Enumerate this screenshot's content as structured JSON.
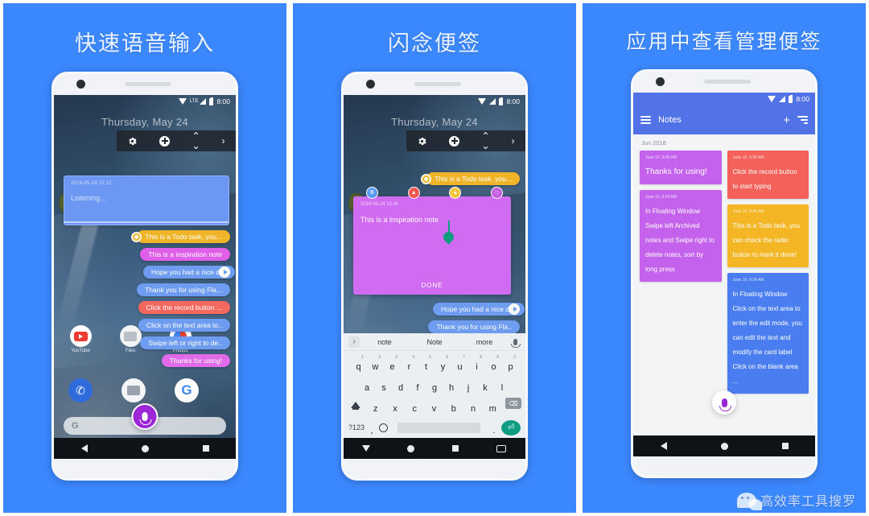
{
  "panels": [
    {
      "title": "快速语音输入",
      "status": {
        "time": "8:00",
        "signal_label": "LTE"
      },
      "home": {
        "date": "Thursday, May 24",
        "toolbar_icons": [
          "gear-icon",
          "plus-circle-icon",
          "up-down-arrow-icon",
          "chevron-right-icon"
        ],
        "listening_card": {
          "timestamp": "2018-05-24 13:12",
          "text": "Listening..."
        },
        "bubbles": [
          {
            "text": "This is a Todo task, you...",
            "color": "#f0b429",
            "kind": "todo"
          },
          {
            "text": "This is a  inspiration note",
            "color": "#df5fe8",
            "kind": "note"
          },
          {
            "text": "Hope you had a nice day",
            "color": "#6e9cf0",
            "kind": "audio"
          },
          {
            "text": "Thank you for using Fla...",
            "color": "#6e9cf0",
            "kind": "note"
          },
          {
            "text": "Click the record button ...",
            "color": "#f4685f",
            "kind": "note"
          },
          {
            "text": "Click on the text area to..",
            "color": "#6e9cf0",
            "kind": "note"
          },
          {
            "text": "Swipe left or right to de..",
            "color": "#6e9cf0",
            "kind": "note"
          },
          {
            "text": "Thanks for using!",
            "color": "#e06ae8",
            "kind": "note"
          }
        ],
        "apps": [
          {
            "label": "YouTube",
            "icon": "youtube-icon"
          },
          {
            "label": "Files",
            "icon": "files-icon"
          },
          {
            "label": "Photos",
            "icon": "photos-icon"
          }
        ],
        "dock": [
          {
            "label": "Phone",
            "icon": "phone-icon",
            "glyph": "✆"
          },
          {
            "label": "Messages",
            "icon": "messages-icon",
            "glyph": ""
          },
          {
            "label": "Google",
            "icon": "google-icon",
            "glyph": "G"
          }
        ],
        "search_placeholder": "G",
        "mic_fab": "mic-icon"
      }
    },
    {
      "title": "闪念便签",
      "status": {
        "time": "8:00"
      },
      "home": {
        "date": "Thursday, May 24",
        "todo_bubble": "This is a Todo task, you...",
        "edit_card": {
          "timestamp": "2018-05-24 12:40",
          "text": "This is a  inspiration note",
          "done_label": "DONE"
        },
        "labels": [
          {
            "name": "label-blue",
            "color": "#5b9bf5",
            "glyph": "B"
          },
          {
            "name": "label-red",
            "color": "#f2584f",
            "glyph": "▲"
          },
          {
            "name": "label-yellow",
            "color": "#f6c544",
            "glyph": "✦"
          },
          {
            "name": "label-purple",
            "color": "#c45fe0",
            "glyph": "♡"
          }
        ],
        "bubbles": [
          {
            "text": "Hope you had a nice day",
            "color": "#6e9cf0",
            "kind": "audio"
          },
          {
            "text": "Thank you for using Fla..",
            "color": "#6e9cf0",
            "kind": "note"
          }
        ]
      },
      "keyboard": {
        "suggestions": [
          "note",
          "Note",
          "more"
        ],
        "expand_icon": "chevron-right-icon",
        "mic_icon": "mic-icon",
        "row1": [
          {
            "k": "q",
            "n": "1"
          },
          {
            "k": "w",
            "n": "2"
          },
          {
            "k": "e",
            "n": "3"
          },
          {
            "k": "r",
            "n": "4"
          },
          {
            "k": "t",
            "n": "5"
          },
          {
            "k": "y",
            "n": "6"
          },
          {
            "k": "u",
            "n": "7"
          },
          {
            "k": "i",
            "n": "8"
          },
          {
            "k": "o",
            "n": "9"
          },
          {
            "k": "p",
            "n": "0"
          }
        ],
        "row2": [
          "a",
          "s",
          "d",
          "f",
          "g",
          "h",
          "j",
          "k",
          "l"
        ],
        "row3": [
          "z",
          "x",
          "c",
          "v",
          "b",
          "n",
          "m"
        ],
        "num_key": "?123",
        "comma_key": ",",
        "period_key": ".",
        "emoji_key": "emoji-icon",
        "shift_key": "shift-icon",
        "backspace_key": "backspace-icon",
        "enter_key": "enter-icon",
        "space_key": "space-bar"
      }
    },
    {
      "title": "应用中查看管理便签",
      "status": {
        "time": "8:00"
      },
      "notes_app": {
        "app_title": "Notes",
        "menu_icon": "hamburger-menu-icon",
        "add_icon": "plus-icon",
        "sort_icon": "sort-icon",
        "month_header": "Jun 2018",
        "cards_left": [
          {
            "timestamp": "June 10, 9:36 AM",
            "text": "Thanks for using!",
            "color": "#c462ee",
            "size": "big"
          },
          {
            "timestamp": "June 10, 9:34 AM",
            "text": "In Floating Window Swipe left Archived notes and Swipe right to delete notes, sort by long press",
            "color": "#c462ee",
            "size": "normal"
          }
        ],
        "cards_right": [
          {
            "timestamp": "June 10, 9:35 AM",
            "text": "Click the record button to start typing",
            "color": "#f4615a",
            "size": "normal"
          },
          {
            "timestamp": "June 10, 9:35 AM",
            "text": "This is a Todo task, you can check the radio button to mark it done!",
            "color": "#f5b625",
            "size": "normal"
          },
          {
            "timestamp": "June 10, 9:34 AM",
            "text": "In Floating Window Click on the text area to enter the edit mode, you can edit the text and modify the card label Click on the blank area ...",
            "color": "#4a7ef0",
            "size": "normal"
          }
        ],
        "fab_icon": "mic-icon"
      }
    }
  ],
  "watermark": {
    "text": "高效率工具搜罗",
    "icon": "wechat-icon"
  },
  "colors": {
    "background": "#3b87fd",
    "accent": "#5272e8",
    "mic": "#9c27d6"
  }
}
